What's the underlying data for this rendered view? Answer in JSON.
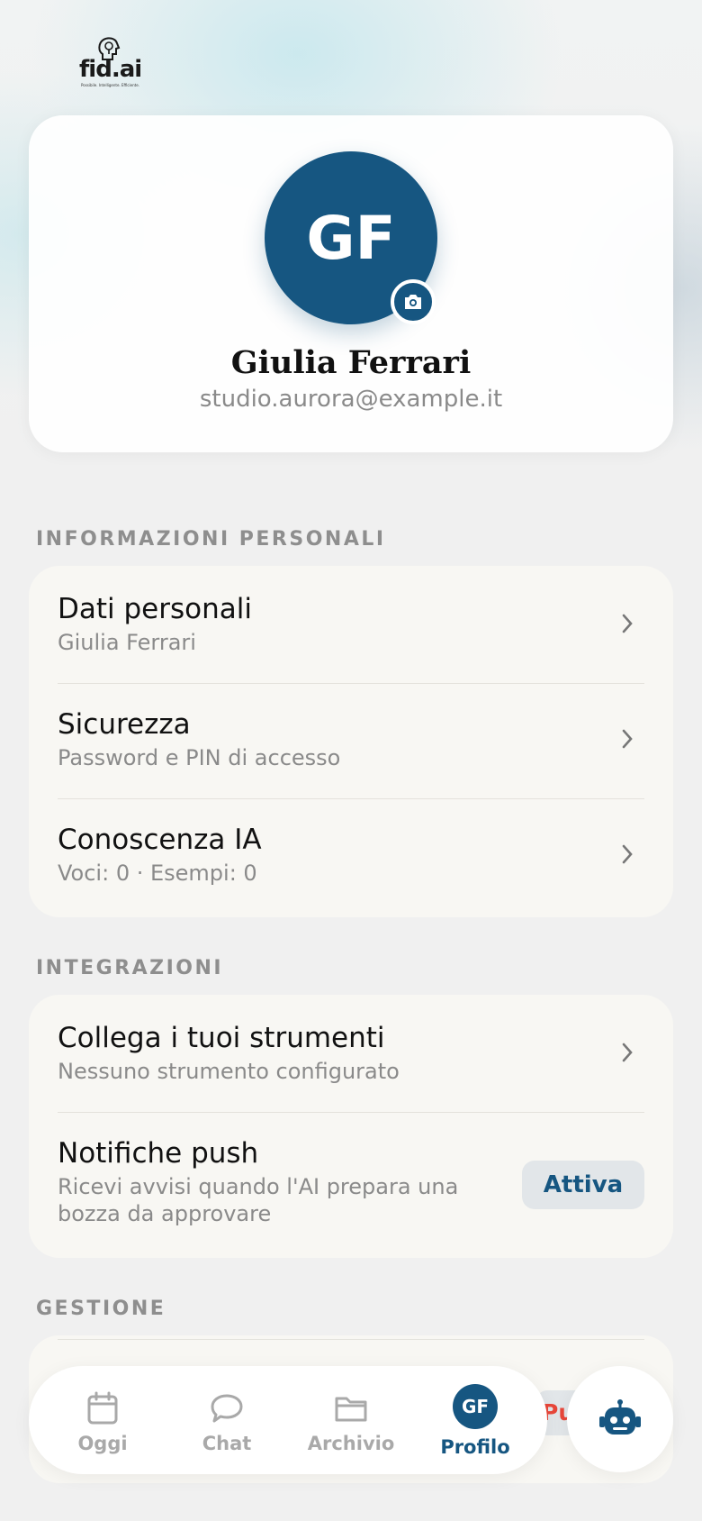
{
  "brand": {
    "logo_text": "fid.ai",
    "tagline": "Possibile. Intelligente. Efficiente."
  },
  "profile": {
    "initials": "GF",
    "name": "Giulia Ferrari",
    "email": "studio.aurora@example.it",
    "camera_icon": "camera-icon"
  },
  "sections": {
    "personal": {
      "title": "INFORMAZIONI PERSONALI",
      "items": [
        {
          "title": "Dati personali",
          "subtitle": "Giulia Ferrari"
        },
        {
          "title": "Sicurezza",
          "subtitle": "Password e PIN di accesso"
        },
        {
          "title": "Conoscenza IA",
          "subtitle": "Voci: 0 · Esempi: 0"
        }
      ]
    },
    "integrations": {
      "title": "INTEGRAZIONI",
      "items": [
        {
          "title": "Collega i tuoi strumenti",
          "subtitle": "Nessuno strumento configurato"
        },
        {
          "title": "Notifiche push",
          "subtitle": "Ricevi avvisi quando l'AI prepara una bozza da approvare",
          "action_label": "Attiva"
        }
      ]
    },
    "management": {
      "title": "GESTIONE",
      "peek_label": "Pu"
    }
  },
  "nav": {
    "items": [
      {
        "label": "Oggi",
        "icon": "calendar-icon"
      },
      {
        "label": "Chat",
        "icon": "chat-bubble-icon"
      },
      {
        "label": "Archivio",
        "icon": "folder-icon"
      },
      {
        "label": "Profilo",
        "icon": "avatar",
        "initials": "GF",
        "active": true
      }
    ],
    "assistant_icon": "robot-icon"
  },
  "colors": {
    "primary": "#165681",
    "background": "#f0f0f0",
    "card": "#f8f7f3",
    "muted_text": "#8a8a8a",
    "danger": "#e8473a"
  }
}
